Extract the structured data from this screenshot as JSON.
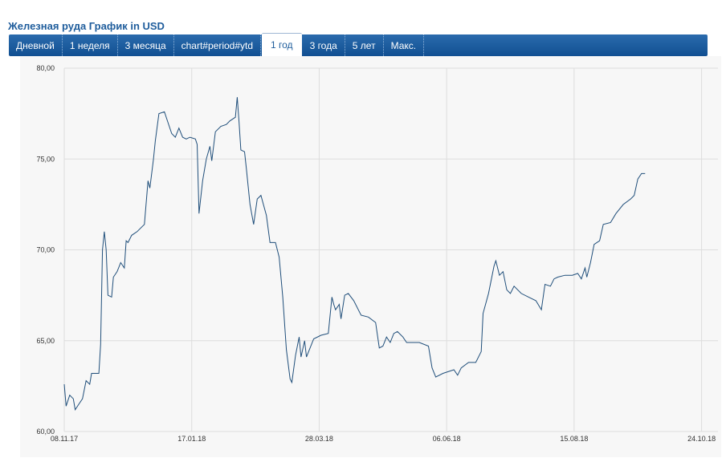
{
  "title": "Железная руда График in USD",
  "tabs": [
    {
      "label": "Дневной",
      "active": false
    },
    {
      "label": "1 неделя",
      "active": false
    },
    {
      "label": "3 месяца",
      "active": false
    },
    {
      "label": "chart#period#ytd",
      "active": false
    },
    {
      "label": "1 год",
      "active": true
    },
    {
      "label": "3 года",
      "active": false
    },
    {
      "label": "5 лет",
      "active": false
    },
    {
      "label": "Макс.",
      "active": false
    }
  ],
  "colors": {
    "tab_bar": "#1a5a9e",
    "line": "#1f4e7a",
    "plot_bg": "#f7f7f7",
    "grid": "#dddddd"
  },
  "chart_data": {
    "type": "line",
    "x_start": "2017-11-08",
    "x_end": "2018-11-02",
    "x_ticks": [
      {
        "date": "2017-11-08",
        "label": "08.11.17"
      },
      {
        "date": "2018-01-17",
        "label": "17.01.18"
      },
      {
        "date": "2018-03-28",
        "label": "28.03.18"
      },
      {
        "date": "2018-06-06",
        "label": "06.06.18"
      },
      {
        "date": "2018-08-15",
        "label": "15.08.18"
      },
      {
        "date": "2018-10-24",
        "label": "24.10.18"
      }
    ],
    "y_ticks": [
      {
        "value": 60,
        "label": "60,00"
      },
      {
        "value": 65,
        "label": "65,00"
      },
      {
        "value": 70,
        "label": "70,00"
      },
      {
        "value": 75,
        "label": "75,00"
      },
      {
        "value": 80,
        "label": "80,00"
      }
    ],
    "ylim": [
      60,
      80
    ],
    "grid": true,
    "series": [
      {
        "points": [
          [
            "2017-11-08",
            62.6
          ],
          [
            "2017-11-09",
            61.4
          ],
          [
            "2017-11-11",
            62.0
          ],
          [
            "2017-11-13",
            61.8
          ],
          [
            "2017-11-14",
            61.2
          ],
          [
            "2017-11-16",
            61.5
          ],
          [
            "2017-11-18",
            61.8
          ],
          [
            "2017-11-20",
            62.8
          ],
          [
            "2017-11-22",
            62.6
          ],
          [
            "2017-11-23",
            63.2
          ],
          [
            "2017-11-27",
            63.2
          ],
          [
            "2017-11-28",
            64.8
          ],
          [
            "2017-11-29",
            70.0
          ],
          [
            "2017-11-30",
            71.0
          ],
          [
            "2017-12-01",
            70.0
          ],
          [
            "2017-12-02",
            67.5
          ],
          [
            "2017-12-04",
            67.4
          ],
          [
            "2017-12-05",
            68.5
          ],
          [
            "2017-12-07",
            68.8
          ],
          [
            "2017-12-09",
            69.3
          ],
          [
            "2017-12-11",
            69.0
          ],
          [
            "2017-12-12",
            70.5
          ],
          [
            "2017-12-13",
            70.4
          ],
          [
            "2017-12-15",
            70.8
          ],
          [
            "2017-12-18",
            71.0
          ],
          [
            "2017-12-20",
            71.2
          ],
          [
            "2017-12-22",
            71.4
          ],
          [
            "2017-12-24",
            73.8
          ],
          [
            "2017-12-25",
            73.4
          ],
          [
            "2017-12-27",
            75.0
          ],
          [
            "2017-12-28",
            76.0
          ],
          [
            "2017-12-30",
            77.5
          ],
          [
            "2018-01-02",
            77.6
          ],
          [
            "2018-01-04",
            77.0
          ],
          [
            "2018-01-06",
            76.4
          ],
          [
            "2018-01-08",
            76.2
          ],
          [
            "2018-01-10",
            76.7
          ],
          [
            "2018-01-12",
            76.2
          ],
          [
            "2018-01-14",
            76.1
          ],
          [
            "2018-01-16",
            76.2
          ],
          [
            "2018-01-19",
            76.1
          ],
          [
            "2018-01-20",
            75.8
          ],
          [
            "2018-01-21",
            72.0
          ],
          [
            "2018-01-23",
            73.8
          ],
          [
            "2018-01-25",
            75.0
          ],
          [
            "2018-01-27",
            75.7
          ],
          [
            "2018-01-28",
            74.9
          ],
          [
            "2018-01-30",
            76.5
          ],
          [
            "2018-02-02",
            76.8
          ],
          [
            "2018-02-05",
            76.9
          ],
          [
            "2018-02-07",
            77.1
          ],
          [
            "2018-02-10",
            77.3
          ],
          [
            "2018-02-11",
            78.4
          ],
          [
            "2018-02-12",
            77.0
          ],
          [
            "2018-02-13",
            75.5
          ],
          [
            "2018-02-15",
            75.4
          ],
          [
            "2018-02-16",
            74.5
          ],
          [
            "2018-02-18",
            72.5
          ],
          [
            "2018-02-20",
            71.4
          ],
          [
            "2018-02-22",
            72.8
          ],
          [
            "2018-02-24",
            73.0
          ],
          [
            "2018-02-27",
            71.9
          ],
          [
            "2018-03-01",
            70.4
          ],
          [
            "2018-03-04",
            70.4
          ],
          [
            "2018-03-06",
            69.6
          ],
          [
            "2018-03-08",
            67.4
          ],
          [
            "2018-03-10",
            64.5
          ],
          [
            "2018-03-12",
            62.9
          ],
          [
            "2018-03-13",
            62.7
          ],
          [
            "2018-03-15",
            64.2
          ],
          [
            "2018-03-17",
            65.2
          ],
          [
            "2018-03-18",
            64.1
          ],
          [
            "2018-03-20",
            65.0
          ],
          [
            "2018-03-21",
            64.1
          ],
          [
            "2018-03-23",
            64.6
          ],
          [
            "2018-03-25",
            65.1
          ],
          [
            "2018-03-29",
            65.3
          ],
          [
            "2018-04-02",
            65.4
          ],
          [
            "2018-04-04",
            67.4
          ],
          [
            "2018-04-05",
            67.0
          ],
          [
            "2018-04-06",
            66.7
          ],
          [
            "2018-04-08",
            67.0
          ],
          [
            "2018-04-09",
            66.2
          ],
          [
            "2018-04-11",
            67.5
          ],
          [
            "2018-04-13",
            67.6
          ],
          [
            "2018-04-16",
            67.2
          ],
          [
            "2018-04-20",
            66.4
          ],
          [
            "2018-04-24",
            66.3
          ],
          [
            "2018-04-28",
            66.0
          ],
          [
            "2018-04-30",
            64.6
          ],
          [
            "2018-05-02",
            64.7
          ],
          [
            "2018-05-04",
            65.2
          ],
          [
            "2018-05-06",
            64.9
          ],
          [
            "2018-05-08",
            65.4
          ],
          [
            "2018-05-10",
            65.5
          ],
          [
            "2018-05-13",
            65.2
          ],
          [
            "2018-05-15",
            64.9
          ],
          [
            "2018-05-22",
            64.9
          ],
          [
            "2018-05-27",
            64.7
          ],
          [
            "2018-05-29",
            63.5
          ],
          [
            "2018-05-31",
            63.0
          ],
          [
            "2018-06-04",
            63.2
          ],
          [
            "2018-06-10",
            63.4
          ],
          [
            "2018-06-12",
            63.1
          ],
          [
            "2018-06-14",
            63.5
          ],
          [
            "2018-06-18",
            63.8
          ],
          [
            "2018-06-22",
            63.8
          ],
          [
            "2018-06-25",
            64.4
          ],
          [
            "2018-06-26",
            66.5
          ],
          [
            "2018-06-29",
            67.6
          ],
          [
            "2018-07-02",
            69.1
          ],
          [
            "2018-07-03",
            69.4
          ],
          [
            "2018-07-05",
            68.6
          ],
          [
            "2018-07-07",
            68.8
          ],
          [
            "2018-07-09",
            67.8
          ],
          [
            "2018-07-11",
            67.6
          ],
          [
            "2018-07-13",
            68.0
          ],
          [
            "2018-07-17",
            67.6
          ],
          [
            "2018-07-21",
            67.4
          ],
          [
            "2018-07-25",
            67.2
          ],
          [
            "2018-07-28",
            66.7
          ],
          [
            "2018-07-30",
            68.1
          ],
          [
            "2018-08-02",
            68.0
          ],
          [
            "2018-08-04",
            68.4
          ],
          [
            "2018-08-06",
            68.5
          ],
          [
            "2018-08-10",
            68.6
          ],
          [
            "2018-08-14",
            68.6
          ],
          [
            "2018-08-17",
            68.7
          ],
          [
            "2018-08-19",
            68.4
          ],
          [
            "2018-08-21",
            69.0
          ],
          [
            "2018-08-22",
            68.5
          ],
          [
            "2018-08-24",
            69.3
          ],
          [
            "2018-08-26",
            70.3
          ],
          [
            "2018-08-29",
            70.5
          ],
          [
            "2018-08-31",
            71.4
          ],
          [
            "2018-09-04",
            71.5
          ],
          [
            "2018-09-07",
            72.0
          ],
          [
            "2018-09-11",
            72.5
          ],
          [
            "2018-09-15",
            72.8
          ],
          [
            "2018-09-17",
            73.0
          ],
          [
            "2018-09-19",
            73.9
          ],
          [
            "2018-09-21",
            74.2
          ],
          [
            "2018-09-23",
            74.2
          ]
        ]
      }
    ]
  }
}
